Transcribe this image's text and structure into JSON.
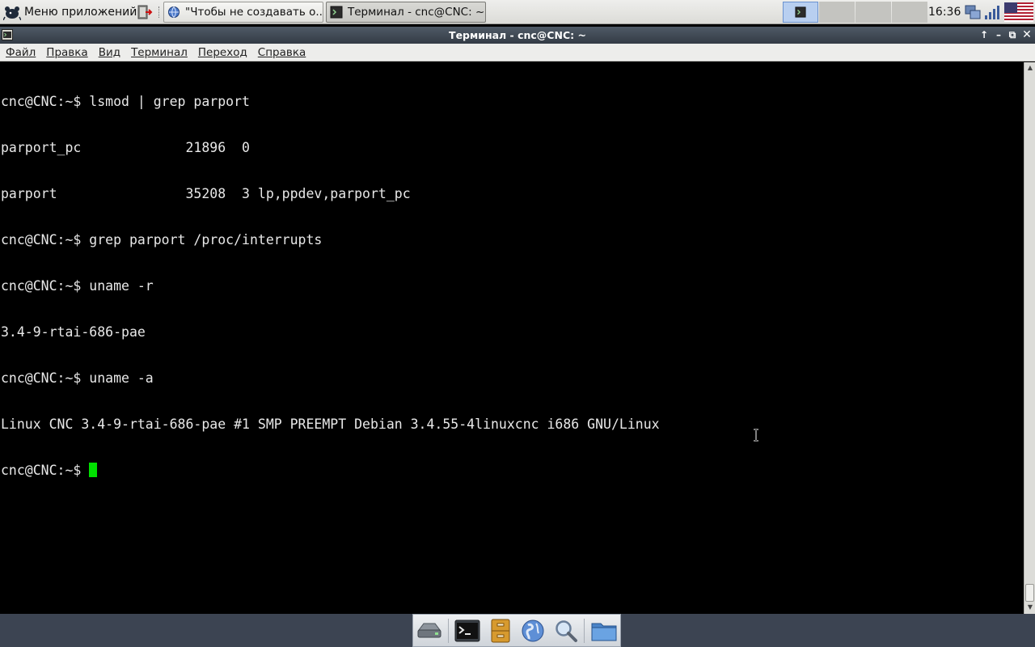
{
  "top_panel": {
    "app_menu_label": "Меню приложений",
    "tasks": [
      {
        "label": "\"Чтобы не создавать о...",
        "icon": "browser-icon",
        "active": false
      },
      {
        "label": "Терминал - cnc@CNC: ~",
        "icon": "terminal-icon",
        "active": true
      }
    ],
    "clock": "16:36",
    "tray_icons": [
      "network-icon",
      "signal-strength-icon",
      "us-flag-icon"
    ]
  },
  "window": {
    "title": "Терминал - cnc@CNC: ~"
  },
  "menubar": {
    "items": [
      "Файл",
      "Правка",
      "Вид",
      "Терминал",
      "Переход",
      "Справка"
    ]
  },
  "terminal": {
    "lines": [
      "cnc@CNC:~$ lsmod | grep parport",
      "parport_pc             21896  0",
      "parport                35208  3 lp,ppdev,parport_pc",
      "cnc@CNC:~$ grep parport /proc/interrupts",
      "cnc@CNC:~$ uname -r",
      "3.4-9-rtai-686-pae",
      "cnc@CNC:~$ uname -a",
      "Linux CNC 3.4-9-rtai-686-pae #1 SMP PREEMPT Debian 3.4.55-4linuxcnc i686 GNU/Linux"
    ],
    "prompt": "cnc@CNC:~$ "
  },
  "dock": {
    "items": [
      "drive-icon",
      "terminal-icon",
      "file-cabinet-icon",
      "web-browser-icon",
      "search-icon",
      "folder-icon"
    ]
  },
  "colors": {
    "cursor": "#00e000",
    "titlebar": "#3a424c",
    "terminal_bg": "#000000"
  }
}
